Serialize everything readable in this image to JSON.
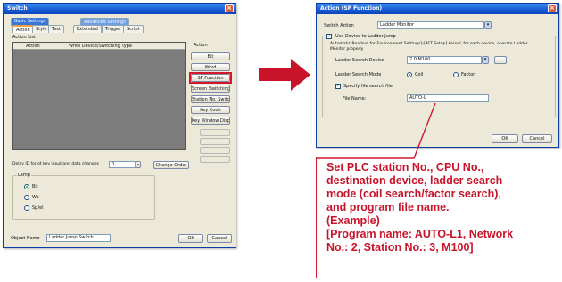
{
  "left_dialog": {
    "title": "Switch",
    "tabs_top": [
      "Basic Settings",
      "Advanced Settings"
    ],
    "tabs": [
      "Action",
      "Style",
      "Text",
      "Extended",
      "Trigger",
      "Script"
    ],
    "action_list_label": "Action List",
    "columns": [
      "Action",
      "Write Device/Switching Type"
    ],
    "action_label": "Action",
    "buttons": [
      "Bit",
      "Word",
      "SP Function",
      "Screen Switching",
      "Station No. Switching",
      "Key Code",
      "Key Window Display"
    ],
    "disabled_buttons": [
      "",
      "",
      "",
      ""
    ],
    "delay_label": "Delay ID for ot key input and data changes",
    "delay_value": "0",
    "change_order": "Change Order",
    "lamp_label": "Lamp",
    "lamp_options": [
      "Bit",
      "Wo",
      "Sp/el"
    ],
    "object_name_label": "Object Name",
    "object_name_value": "Ladder Jump Switch",
    "ok": "OK",
    "cancel": "Cancel"
  },
  "right_dialog": {
    "title": "Action (SP Function)",
    "switch_action_label": "Switch Action",
    "switch_action_value": "Ladder Monitor",
    "use_device_label": "Use Device to Ladder Jump",
    "note": "Automatic Readout for[Environment Settings]-[BET Setup] kernel, for each device, operate Ladder Monitor properly",
    "search_device_label": "Ladder Search Device",
    "search_device_value": "2.0 M100",
    "search_mode_label": "Ladder Search Mode",
    "mode_options": [
      "Coil",
      "Factor"
    ],
    "specify_file_label": "Specify file search file",
    "file_name_label": "File Name:",
    "file_name_value": "AUTO-L",
    "ok": "OK",
    "cancel": "Cancel"
  },
  "callout": {
    "lines": [
      "Set PLC station No., CPU No.,",
      "destination device, ladder search",
      "mode (coil search/factor search),",
      "and program file name.",
      "(Example)",
      "[Program name: AUTO-L1, Network",
      "No.: 2, Station No.: 3, M100]"
    ]
  },
  "colors": {
    "arrow": "#c8132b",
    "callout_text": "#c8132b",
    "highlight": "#d4182b",
    "titlebar": "#1558d4"
  }
}
